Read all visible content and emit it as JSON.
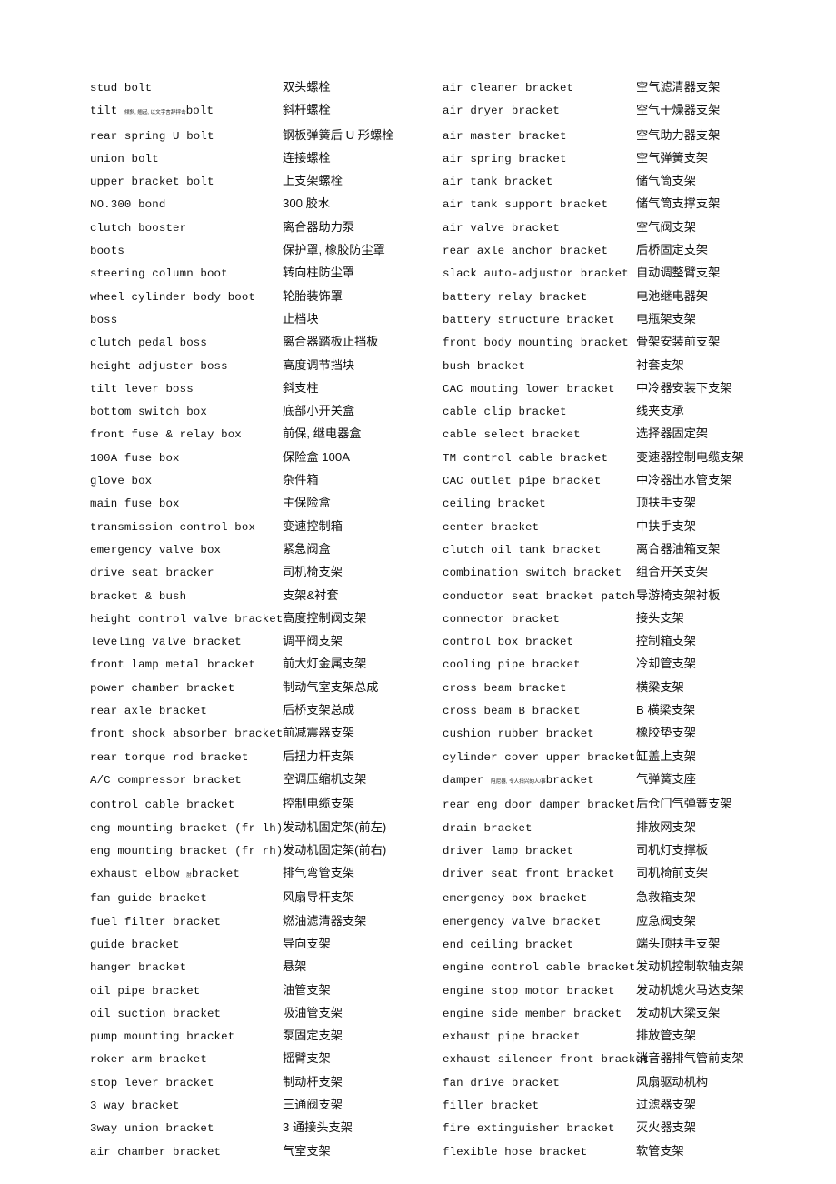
{
  "document": {
    "type": "glossary-table",
    "title": "Automotive Parts English-Chinese Glossary",
    "page_background": "#ffffff",
    "text_color": "#111111",
    "columns": [
      "English term",
      "Chinese term",
      "English term",
      "Chinese term"
    ]
  },
  "rows": [
    {
      "en1": "stud bolt",
      "zh1": "双头螺栓",
      "en2": "air cleaner bracket",
      "zh2": "空气滤清器支架"
    },
    {
      "en1": "tilt ",
      "en1_gloss": "倾斜, 翘起, 以文字言辞抨击",
      "en1_tail": "bolt",
      "zh1": "斜杆螺栓",
      "en2": "air dryer bracket",
      "zh2": "空气干燥器支架"
    },
    {
      "en1": "rear spring U bolt",
      "zh1": "钢板弹簧后 U 形螺栓",
      "en2": "air master bracket",
      "zh2": "空气助力器支架"
    },
    {
      "en1": "union bolt",
      "zh1": "连接螺栓",
      "en2": "air spring bracket",
      "zh2": "空气弹簧支架"
    },
    {
      "en1": "upper bracket bolt",
      "zh1": "上支架螺栓",
      "en2": "air tank bracket",
      "zh2": "储气筒支架"
    },
    {
      "en1": "NO.300 bond",
      "zh1": "300 胶水",
      "en2": "air tank support bracket",
      "zh2": "储气筒支撑支架"
    },
    {
      "en1": "clutch booster",
      "zh1": "离合器助力泵",
      "en2": "air valve bracket",
      "zh2": "空气阀支架"
    },
    {
      "en1": "boots",
      "zh1": "保护罩, 橡胶防尘罩",
      "en2": "rear axle anchor bracket",
      "zh2": "后桥固定支架"
    },
    {
      "en1": "steering column boot",
      "zh1": "转向柱防尘罩",
      "en2": "slack auto-adjustor bracket",
      "zh2": "自动调整臂支架"
    },
    {
      "en1": "wheel cylinder body boot",
      "zh1": "轮胎装饰罩",
      "en2": "battery relay bracket",
      "zh2": "电池继电器架"
    },
    {
      "en1": "boss",
      "zh1": "止档块",
      "en2": "battery structure bracket",
      "zh2": "电瓶架支架"
    },
    {
      "en1": "clutch pedal boss",
      "zh1": "离合器踏板止挡板",
      "en2": "front body mounting bracket",
      "zh2": "骨架安装前支架"
    },
    {
      "en1": "height adjuster boss",
      "zh1": "高度调节挡块",
      "en2": "bush bracket",
      "zh2": "衬套支架"
    },
    {
      "en1": "tilt lever boss",
      "zh1": "斜支柱",
      "en2": "CAC mouting lower bracket",
      "zh2": "中冷器安装下支架"
    },
    {
      "en1": "bottom switch box",
      "zh1": "底部小开关盒",
      "en2": "cable clip bracket",
      "zh2": "线夹支承"
    },
    {
      "en1": "front fuse & relay box",
      "zh1": "前保, 继电器盒",
      "en2": "cable select bracket",
      "zh2": "选择器固定架"
    },
    {
      "en1": "100A fuse box",
      "zh1": "保险盒 100A",
      "en2": "TM control cable bracket",
      "zh2": "变速器控制电缆支架"
    },
    {
      "en1": "glove box",
      "zh1": "杂件箱",
      "en2": "CAC outlet pipe bracket",
      "zh2": "中冷器出水管支架"
    },
    {
      "en1": "main fuse box",
      "zh1": "主保险盒",
      "en2": "ceiling bracket",
      "zh2": "顶扶手支架"
    },
    {
      "en1": "transmission control box",
      "zh1": "变速控制箱",
      "en2": "center bracket",
      "zh2": "中扶手支架"
    },
    {
      "en1": "emergency valve box",
      "zh1": "紧急阀盒",
      "en2": "clutch oil tank bracket",
      "zh2": "离合器油箱支架"
    },
    {
      "en1": "drive seat bracker",
      "zh1": "司机椅支架",
      "en2": "combination switch bracket",
      "zh2": "组合开关支架"
    },
    {
      "en1": "bracket & bush",
      "zh1": "支架&衬套",
      "en2": "conductor seat bracket patch",
      "zh2": "导游椅支架衬板"
    },
    {
      "en1": "height control valve bracket",
      "zh1": "高度控制阀支架",
      "en2": "connector bracket",
      "zh2": "接头支架"
    },
    {
      "en1": "leveling valve bracket",
      "zh1": "调平阀支架",
      "en2": "control box bracket",
      "zh2": "控制箱支架"
    },
    {
      "en1": "front lamp metal bracket",
      "zh1": "前大灯金属支架",
      "en2": "cooling pipe bracket",
      "zh2": "冷却管支架"
    },
    {
      "en1": "power chamber bracket",
      "zh1": "制动气室支架总成",
      "en2": "cross beam bracket",
      "zh2": "横梁支架"
    },
    {
      "en1": "rear axle bracket",
      "zh1": "后桥支架总成",
      "en2": "cross beam B bracket",
      "zh2": "B 横梁支架"
    },
    {
      "en1": "front shock absorber bracket",
      "zh1": "前减震器支架",
      "en2": "cushion rubber bracket",
      "zh2": "橡胶垫支架"
    },
    {
      "en1": "rear torque rod bracket",
      "zh1": "后扭力杆支架",
      "en2": "cylinder cover upper bracket",
      "zh2": "缸盖上支架"
    },
    {
      "en1": "A/C compressor bracket",
      "zh1": "空调压缩机支架",
      "en2": "damper ",
      "en2_gloss": "阻尼器, 令人扫兴的人/事",
      "en2_tail": "bracket",
      "zh2": "气弹簧支座"
    },
    {
      "en1": "control cable bracket",
      "zh1": "控制电缆支架",
      "en2": "rear eng door damper bracket",
      "zh2": "后仓门气弹簧支架"
    },
    {
      "en1": "eng mounting bracket (fr lh)",
      "zh1": "发动机固定架(前左)",
      "en2": "drain bracket",
      "zh2": "排放网支架"
    },
    {
      "en1": "eng mounting bracket (fr rh)",
      "zh1": "发动机固定架(前右)",
      "en2": "driver lamp bracket",
      "zh2": "司机灯支撑板"
    },
    {
      "en1": "exhaust elbow ",
      "en1_gloss": "肘",
      "en1_tail": "bracket",
      "zh1": "排气弯管支架",
      "en2": "driver seat front bracket",
      "zh2": "司机椅前支架"
    },
    {
      "en1": "fan guide bracket",
      "zh1": "风扇导杆支架",
      "en2": "emergency box bracket",
      "zh2": "急救箱支架"
    },
    {
      "en1": "fuel filter bracket",
      "zh1": "燃油滤清器支架",
      "en2": "emergency valve bracket",
      "zh2": "应急阀支架"
    },
    {
      "en1": "guide bracket",
      "zh1": "导向支架",
      "en2": "end ceiling bracket",
      "zh2": "端头顶扶手支架"
    },
    {
      "en1": "hanger bracket",
      "zh1": "悬架",
      "en2": "engine control cable bracket",
      "zh2": "发动机控制软轴支架"
    },
    {
      "en1": "oil pipe bracket",
      "zh1": "油管支架",
      "en2": "engine stop motor bracket",
      "zh2": "发动机熄火马达支架"
    },
    {
      "en1": "oil suction bracket",
      "zh1": "吸油管支架",
      "en2": "engine side member bracket",
      "zh2": "发动机大梁支架"
    },
    {
      "en1": "pump mounting bracket",
      "zh1": "泵固定支架",
      "en2": "exhaust pipe bracket",
      "zh2": "排放管支架"
    },
    {
      "en1": "roker arm bracket",
      "zh1": "摇臂支架",
      "en2": "exhaust silencer front bracket",
      "zh2": "消音器排气管前支架"
    },
    {
      "en1": "stop lever bracket",
      "zh1": "制动杆支架",
      "en2": "fan drive bracket",
      "zh2": "风扇驱动机构"
    },
    {
      "en1": "3 way bracket",
      "zh1": "三通阀支架",
      "en2": "filler bracket",
      "zh2": "过滤器支架"
    },
    {
      "en1": "3way union bracket",
      "zh1": "3 通接头支架",
      "en2": "fire extinguisher bracket",
      "zh2": "灭火器支架"
    },
    {
      "en1": "air chamber bracket",
      "zh1": "气室支架",
      "en2": "flexible hose bracket",
      "zh2": "软管支架"
    }
  ]
}
